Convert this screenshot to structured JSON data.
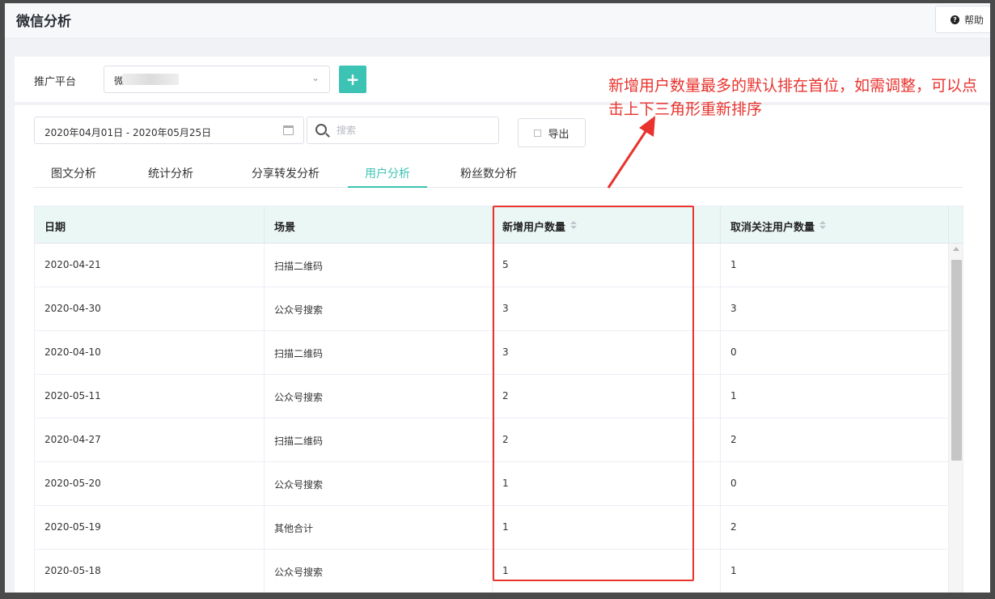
{
  "header": {
    "title": "微信分析",
    "help_label": "帮助"
  },
  "filters": {
    "platform_label": "推广平台",
    "platform_value": "微",
    "add_label": "+",
    "date_range": "2020年04月01日 - 2020年05月25日",
    "search_placeholder": "搜索",
    "export_label": "导出"
  },
  "tabs": [
    {
      "label": "图文分析",
      "active": false
    },
    {
      "label": "统计分析",
      "active": false
    },
    {
      "label": "分享转发分析",
      "active": false
    },
    {
      "label": "用户分析",
      "active": true
    },
    {
      "label": "粉丝数分析",
      "active": false
    }
  ],
  "table": {
    "columns": [
      "日期",
      "场景",
      "新增用户数量",
      "取消关注用户数量"
    ],
    "rows": [
      [
        "2020-04-21",
        "扫描二维码",
        "5",
        "1"
      ],
      [
        "2020-04-30",
        "公众号搜索",
        "3",
        "3"
      ],
      [
        "2020-04-10",
        "扫描二维码",
        "3",
        "0"
      ],
      [
        "2020-05-11",
        "公众号搜索",
        "2",
        "1"
      ],
      [
        "2020-04-27",
        "扫描二维码",
        "2",
        "2"
      ],
      [
        "2020-05-20",
        "公众号搜索",
        "1",
        "0"
      ],
      [
        "2020-05-19",
        "其他合计",
        "1",
        "2"
      ],
      [
        "2020-05-18",
        "公众号搜索",
        "1",
        "1"
      ]
    ]
  },
  "annotation": {
    "text": "新增用户数量最多的默认排在首位，如需调整，可以点击上下三角形重新排序",
    "color": "#e8332e"
  },
  "colors": {
    "accent": "#3cc3b4",
    "header_bg": "#eaf7f5"
  }
}
